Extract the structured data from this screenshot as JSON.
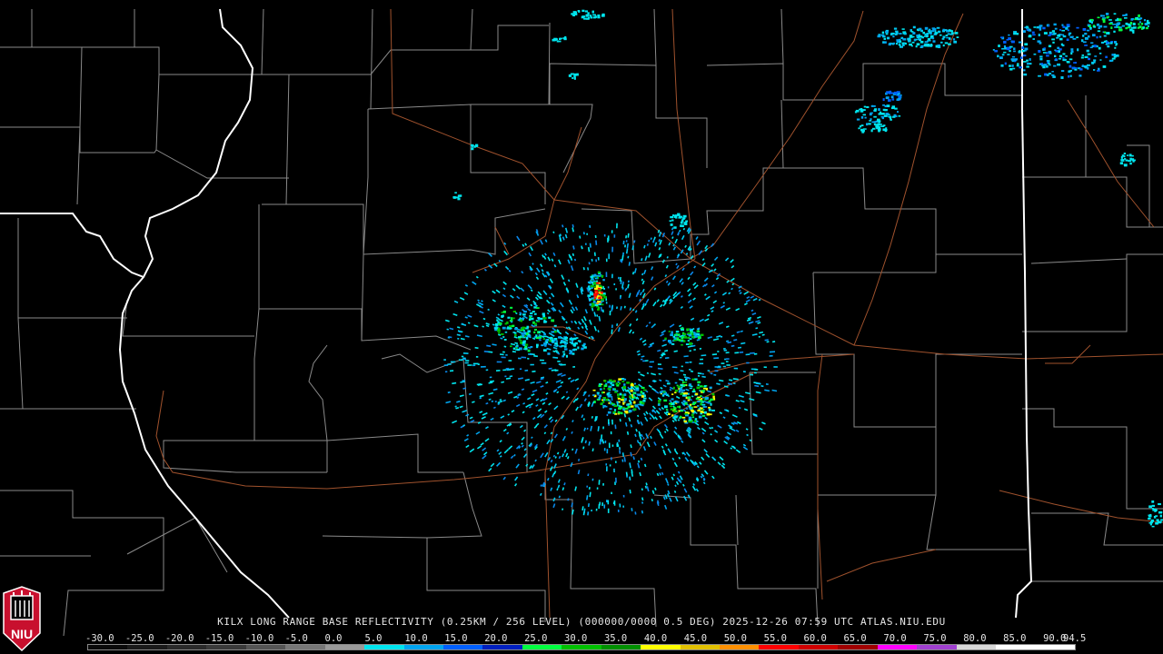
{
  "product_caption": "KILX LONG RANGE BASE REFLECTIVITY (0.25KM / 256 LEVEL) (000000/0000 0.5 DEG) 2025-12-26 07:59 UTC  ATLAS.NIU.EDU",
  "logo_text": "NIU",
  "colors": {
    "background": "#000000",
    "county_lines": "#8a8a8a",
    "state_lines": "#ffffff",
    "highways": "#a0522d",
    "logo_red": "#c8102e"
  },
  "scale": {
    "labels": [
      "-30.0",
      "-25.0",
      "-20.0",
      "-15.0",
      "-10.0",
      "-5.0",
      "0.0",
      "5.0",
      "10.0",
      "15.0",
      "20.0",
      "25.0",
      "30.0",
      "35.0",
      "40.0",
      "45.0",
      "50.0",
      "55.0",
      "60.0",
      "65.0",
      "70.0",
      "75.0",
      "80.0",
      "85.0",
      "90.0",
      "94.5"
    ],
    "colors": [
      "#0a0a0a",
      "#1a1a1a",
      "#2a2a2a",
      "#3a3a3a",
      "#555555",
      "#777777",
      "#9a9a9a",
      "#00e5ee",
      "#00a5f0",
      "#0060ff",
      "#0020c0",
      "#00ff40",
      "#00c000",
      "#009000",
      "#ffff00",
      "#e0c000",
      "#ff9000",
      "#ff0000",
      "#d00000",
      "#a00000",
      "#ff00ff",
      "#a040d0",
      "#d8d8d8",
      "#ffffff",
      "#ffffff"
    ]
  }
}
